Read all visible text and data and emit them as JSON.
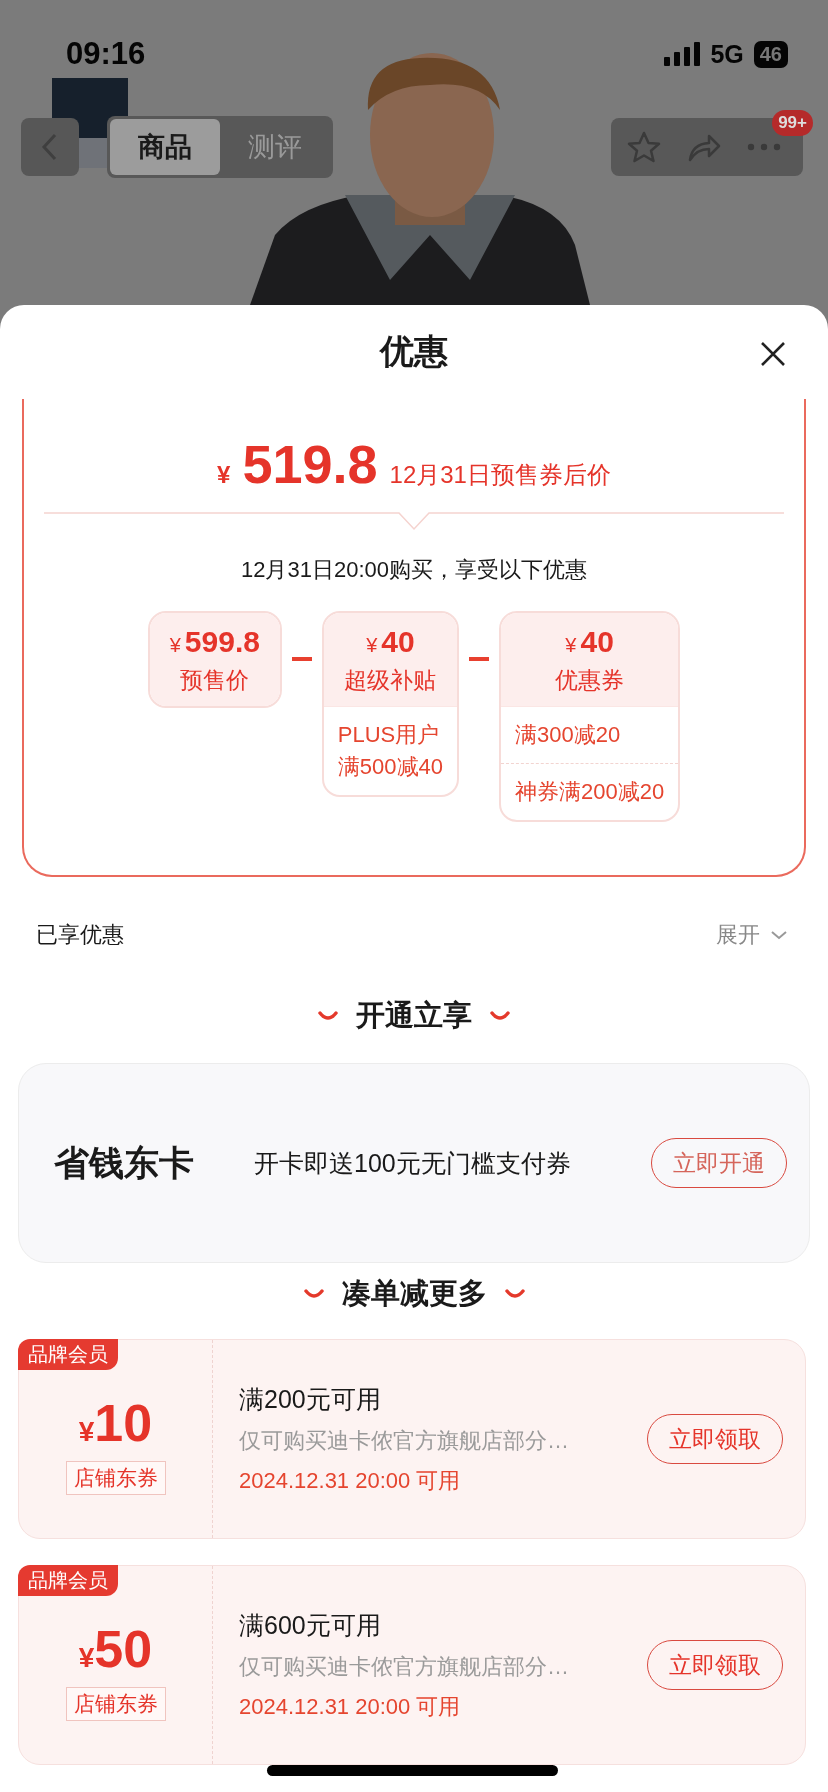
{
  "status_bar": {
    "time": "09:16",
    "network": "5G",
    "battery": "46"
  },
  "nav": {
    "tabs": [
      {
        "label": "商品",
        "selected": true
      },
      {
        "label": "测评",
        "selected": false
      }
    ],
    "badge": "99+"
  },
  "sheet": {
    "title": "优惠"
  },
  "price_summary": {
    "currency": "¥",
    "price": "519.8",
    "caption": "12月31日预售券后价",
    "subtitle": "12月31日20:00购买，享受以下优惠",
    "parts": [
      {
        "currency": "¥",
        "amount": "599.8",
        "label": "预售价"
      },
      {
        "currency": "¥",
        "amount": "40",
        "label": "超级补贴",
        "details": [
          {
            "lines": [
              "PLUS用户",
              "满500减40"
            ]
          }
        ]
      },
      {
        "currency": "¥",
        "amount": "40",
        "label": "优惠券",
        "details": [
          {
            "lines": [
              "满300减20"
            ]
          },
          {
            "lines": [
              "神券满200减20"
            ]
          }
        ]
      }
    ]
  },
  "applied": {
    "label": "已享优惠",
    "toggle": "展开",
    "expanded": false
  },
  "sections": [
    {
      "kind": "membership",
      "title": "开通立享",
      "card": {
        "name": "省钱东卡",
        "description": "开卡即送100元无门槛支付券",
        "button": "立即开通"
      }
    },
    {
      "kind": "coupons",
      "title": "凑单减更多",
      "coupons": [
        {
          "tag": "品牌会员",
          "currency": "¥",
          "amount": "10",
          "type": "店铺东券",
          "condition": "满200元可用",
          "scope": "仅可购买迪卡侬官方旗舰店部分…",
          "time": "2024.12.31 20:00 可用",
          "button": "立即领取"
        },
        {
          "tag": "品牌会员",
          "currency": "¥",
          "amount": "50",
          "type": "店铺东券",
          "condition": "满600元可用",
          "scope": "仅可购买迪卡侬官方旗舰店部分…",
          "time": "2024.12.31 20:00 可用",
          "button": "立即领取"
        }
      ]
    }
  ]
}
